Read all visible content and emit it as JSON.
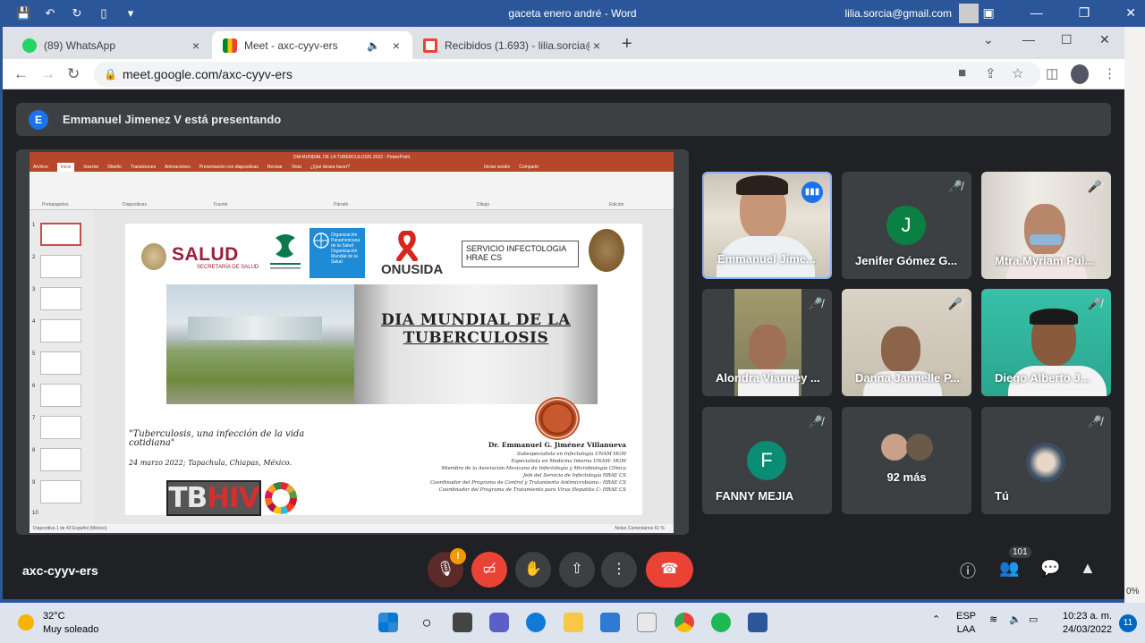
{
  "word": {
    "title": "gaceta enero andré  -  Word",
    "user": "lilia.sorcia@gmail.com",
    "zoom": "0%"
  },
  "tabs": [
    {
      "label": "(89) WhatsApp",
      "close": "×"
    },
    {
      "label": "Meet - axc-cyyv-ers",
      "close": "×"
    },
    {
      "label": "Recibidos (1.693) - lilia.sorcia@gm",
      "close": "×"
    }
  ],
  "address": {
    "url": "meet.google.com/axc-cyyv-ers"
  },
  "meet": {
    "presenter_initial": "E",
    "presenting_text": "Emmanuel Jimenez V está presentando",
    "meeting_code": "axc-cyyv-ers",
    "participant_count": "101",
    "warning_badge": "!"
  },
  "slide": {
    "ppt_title": "DIA MUNDIAL DE LA TUBERCULOSIS 2022 - PowerPoint",
    "ppt_tabs": [
      "Archivo",
      "Inicio",
      "Insertar",
      "Diseño",
      "Transiciones",
      "Animaciones",
      "Presentación con diapositivas",
      "Revisar",
      "Vista",
      "¿Qué desea hacer?",
      "Iniciar sesión",
      "Compartir"
    ],
    "ribbon_groups": [
      "Portapapeles",
      "Diapositivas",
      "Fuente",
      "Párrafo",
      "Dibujo",
      "Edición"
    ],
    "status": "Diapositiva 1 de 43     Español (México)",
    "status_right": "Notas    Comentarios                                 61 %",
    "salud": "SALUD",
    "salud_sub": "SECRETARÍA DE SALUD",
    "who": "Organización Panamericana de la Salud  Organización Mundial de la Salud",
    "onusida": "ONUSIDA",
    "servicio": "SERVICIO INFECTOLOGIA HRAE CS",
    "title": "DIA MUNDIAL DE LA TUBERCULOSIS",
    "quote": "\"Tuberculosis, una infección de la vida cotidiana\"",
    "date": "24 marzo 2022; Tapachula, Chiapas, México.",
    "doctor": "Dr. Emmanuel G. Jiménez Villanueva",
    "credentials": [
      "Subespecialista en Infectología UNAM HGM",
      "Especialista en Medicina Interna UNAM- HGM",
      "Miembro de la Asociación Mexicana de Infectología y Microbiología Clínica",
      "Jefe del  Servicio de Infectología HRAE CS",
      "Coordinador del Programa de Control y Tratamiento Antimicrobiano.- HRAE CS",
      "Coordinador del Programa de Tratamiento para Virus Hepatitis C- HRAE CS"
    ],
    "tbhiv_tb": "TB",
    "tbhiv_hiv": "HIV",
    "thumb_numbers": [
      "1",
      "2",
      "3",
      "4",
      "5",
      "6",
      "7",
      "8",
      "9",
      "10"
    ]
  },
  "participants": [
    {
      "name": "Emmanuel Jime...",
      "speaking": true
    },
    {
      "name": "Jenifer Gómez G...",
      "initial": "J",
      "color": "#0b8043"
    },
    {
      "name": "Mtra.Myriam Pul..."
    },
    {
      "name": "Alondra Vianney ..."
    },
    {
      "name": "Danna Jannelle P..."
    },
    {
      "name": "Diego Alberto J..."
    },
    {
      "name": "FANNY MEJIA",
      "initial": "F",
      "color": "#0b8c74"
    },
    {
      "name": "92 más"
    },
    {
      "name": "Tú"
    }
  ],
  "taskbar": {
    "temp": "32°C",
    "weather": "Muy soleado",
    "lang": "ESP",
    "layout": "LAA",
    "time": "10:23 a. m.",
    "date": "24/03/2022",
    "notifications": "11"
  }
}
